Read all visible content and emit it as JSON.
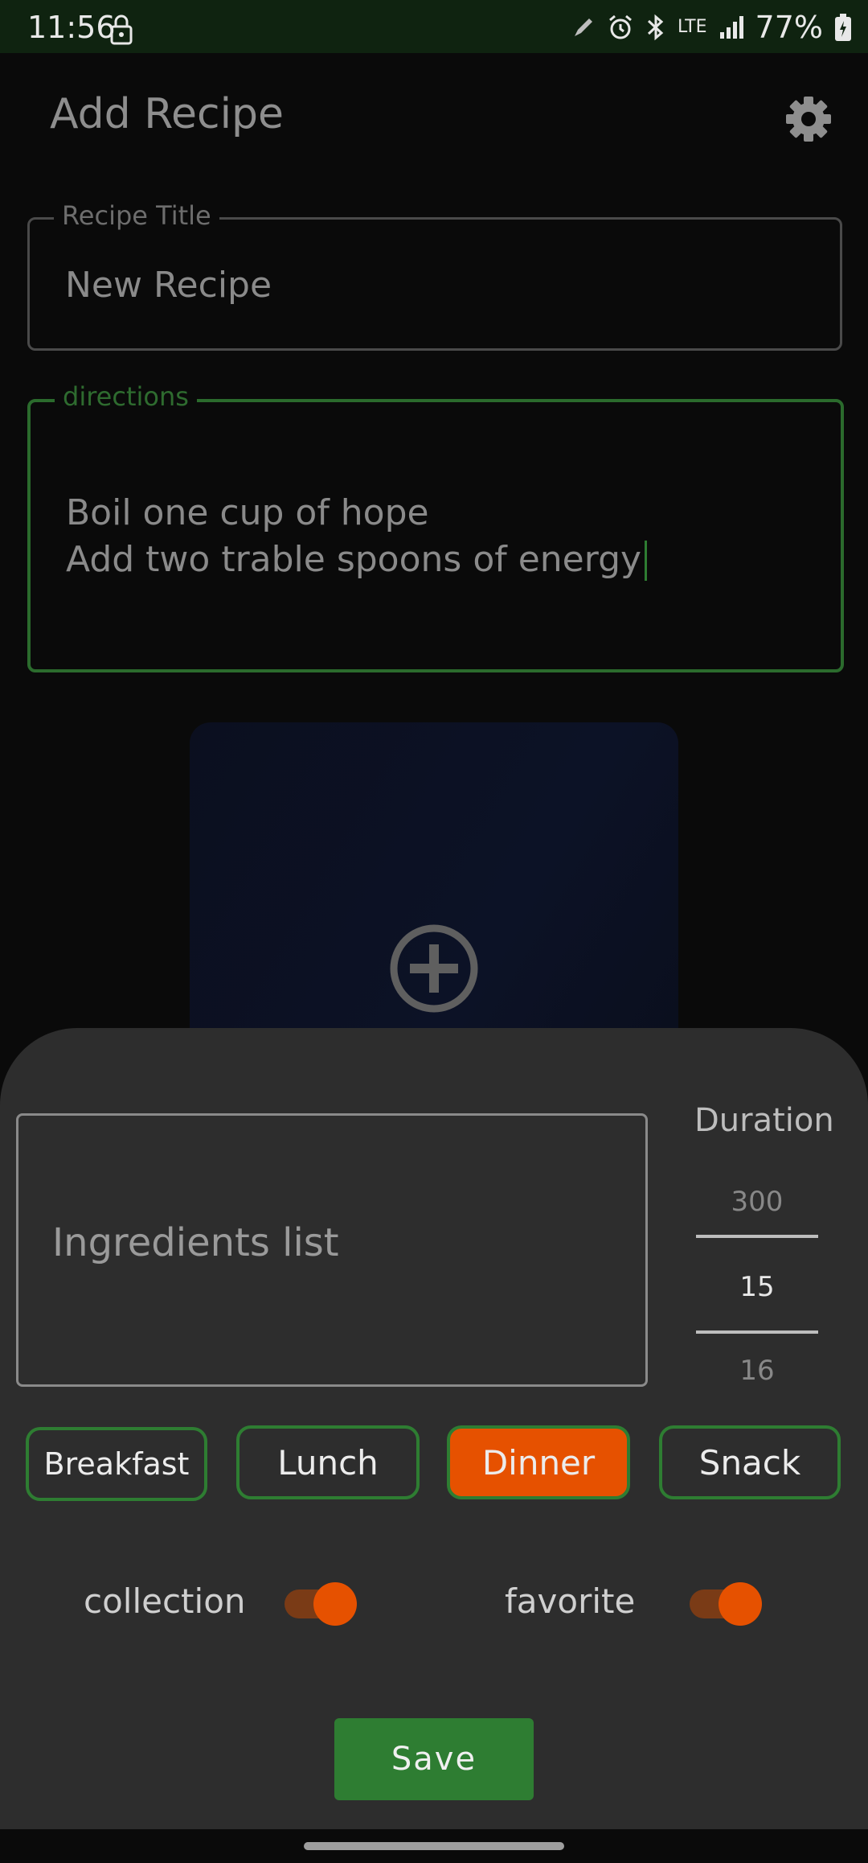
{
  "status_bar": {
    "time": "11:56",
    "network": "LTE",
    "battery": "77%",
    "icons": [
      "lock-icon",
      "edit-icon",
      "alarm-icon",
      "bluetooth-icon",
      "lte-icon",
      "signal-icon",
      "battery-icon"
    ]
  },
  "app_bar": {
    "title": "Add Recipe",
    "settings_icon": "gear-icon"
  },
  "form": {
    "title_label": "Recipe Title",
    "title_value": "New Recipe",
    "directions_label": "directions",
    "directions_lines": [
      "Boil one cup of hope",
      "Add two trable spoons of energy"
    ]
  },
  "image_card": {
    "icon": "add-circle-icon"
  },
  "sheet": {
    "ingredients_placeholder": "Ingredients list",
    "duration": {
      "label": "Duration",
      "prev": "300",
      "selected": "15",
      "next": "16"
    },
    "meals": [
      {
        "label": "Breakfast",
        "selected": false
      },
      {
        "label": "Lunch",
        "selected": false
      },
      {
        "label": "Dinner",
        "selected": true
      },
      {
        "label": "Snack",
        "selected": false
      }
    ],
    "toggles": [
      {
        "label": "collection",
        "on": true
      },
      {
        "label": "favorite",
        "on": true
      }
    ],
    "save_label": "Save"
  },
  "colors": {
    "accent_green": "#2e7d32",
    "accent_orange": "#e65100",
    "sheet_bg": "#2d2d2d",
    "status_bar_bg": "#0f2310"
  }
}
